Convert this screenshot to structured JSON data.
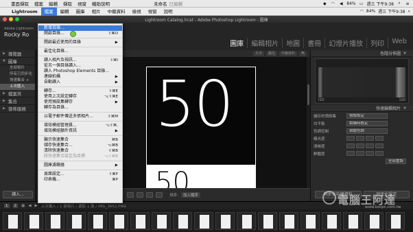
{
  "mac_menubar": {
    "items": [
      "書面擷取",
      "檔案",
      "編輯",
      "擷取",
      "視窗",
      "輔助說明"
    ],
    "tray_title": "未命名",
    "tray_sub": "已編輯",
    "battery": "84%",
    "clock": "週三 下午9:38"
  },
  "app_menubar": {
    "app": "Lightroom",
    "items": [
      "檔案",
      "編輯",
      "圖庫",
      "相片",
      "中繼資料",
      "檢視",
      "視窗",
      "說明"
    ],
    "active_index": 0,
    "battery": "84%",
    "clock": "週三 下午9:38"
  },
  "window_title": "Lightroom Catalog.lrcat - Adobe Photoshop Lightroom - 圖庫",
  "identity": {
    "small": "Adobe Lightroom",
    "big": "Rocky Ro"
  },
  "modules": [
    "圖庫",
    "編輯相片",
    "地圖",
    "書冊",
    "幻燈片播放",
    "列印",
    "Web"
  ],
  "active_module": 0,
  "left_panel": {
    "sections": [
      {
        "label": "導覽器",
        "items": []
      },
      {
        "label": "圖庫",
        "items": [
          "全部相片",
          "所有已同步化",
          "快速集合 +",
          "上次匯入"
        ],
        "selected": 3
      },
      {
        "label": "檔案夾",
        "items": []
      },
      {
        "label": "集合",
        "items": []
      },
      {
        "label": "發佈服務",
        "items": []
      }
    ],
    "import_button": "讀入..."
  },
  "center": {
    "toolbar": [
      "文字",
      "屬性",
      "中繼資料",
      "無"
    ],
    "photo_big_number": "50",
    "photo_second_number": "50"
  },
  "bottom_toolbar": {
    "sort_label": "排序:",
    "sort_value": "加入順序"
  },
  "right_panel": {
    "histogram_label": "色階分佈圖",
    "histogram_info": "ISO",
    "histogram_scale": "100",
    "quick_develop_label": "快速編輯相片",
    "rows": [
      {
        "label": "儲存的預設集",
        "value": "預設設定"
      },
      {
        "label": "白平衡",
        "value": "拍攝時設定"
      },
      {
        "label": "色調控制",
        "value": "自動色調"
      },
      {
        "label": "曝光度",
        "value": ""
      },
      {
        "label": "清晰度",
        "value": ""
      },
      {
        "label": "鮮豔度",
        "value": ""
      }
    ],
    "reset_all": "全部重設",
    "sync_metadata": "同步化中繼資料",
    "sync_settings": "同步化設定"
  },
  "filmstrip_bar": {
    "page1": "1",
    "page2": "2",
    "path": "上次讀入 / 1 張相片 / 選取 1 張 / IMG_3652.PNG"
  },
  "file_menu": {
    "items": [
      {
        "label": "新增目錄...",
        "shortcut": "",
        "highlight": true
      },
      {
        "label": "開啟目錄...",
        "shortcut": "⇧⌘O"
      },
      {
        "sep": true
      },
      {
        "label": "開啟最近使用的目錄",
        "shortcut": "▶"
      },
      {
        "sep": true
      },
      {
        "label": "最佳化目錄...",
        "shortcut": ""
      },
      {
        "sep": true
      },
      {
        "label": "讀入相片及視訊...",
        "shortcut": "⇧⌘I"
      },
      {
        "label": "從另一個目錄讀入...",
        "shortcut": ""
      },
      {
        "label": "讀入 Photoshop Elements 目錄...",
        "shortcut": ""
      },
      {
        "label": "連線拍攝",
        "shortcut": "▶"
      },
      {
        "label": "自動讀入",
        "shortcut": "▶"
      },
      {
        "sep": true
      },
      {
        "label": "轉存...",
        "shortcut": "⇧⌘E"
      },
      {
        "label": "使用上次設定轉存",
        "shortcut": "⌥⇧⌘E"
      },
      {
        "label": "使用預設集轉存",
        "shortcut": "▶"
      },
      {
        "label": "轉存為目錄...",
        "shortcut": ""
      },
      {
        "sep": true
      },
      {
        "label": "以電子郵件傳送多張相片...",
        "shortcut": "⇧⌘M"
      },
      {
        "sep": true
      },
      {
        "label": "增效模組管理員...",
        "shortcut": "⌥⇧⌘,"
      },
      {
        "label": "增效模組額外資訊",
        "shortcut": "▶"
      },
      {
        "sep": true
      },
      {
        "label": "顯示快速集合",
        "shortcut": "⌘B"
      },
      {
        "label": "儲存快速集合...",
        "shortcut": "⌥⌘B"
      },
      {
        "label": "清除快速集合",
        "shortcut": "⇧⌘B"
      },
      {
        "label": "將快速集合設定為目標",
        "shortcut": "⌥⇧⌘B",
        "disabled": true
      },
      {
        "sep": true
      },
      {
        "label": "圖庫濾鏡器",
        "shortcut": "▶"
      },
      {
        "sep": true
      },
      {
        "label": "頁面設定...",
        "shortcut": "⇧⌘P"
      },
      {
        "label": "印表機...",
        "shortcut": "⌘P"
      }
    ]
  },
  "watermark": {
    "text": "電腦王阿達",
    "url": "www.kocpc.com.tw"
  },
  "colors": {
    "menu_highlight": "#3b7bd8",
    "panel_bg": "#2a2a2a",
    "cursor": "#7ac943"
  },
  "filmstrip_count": 19
}
